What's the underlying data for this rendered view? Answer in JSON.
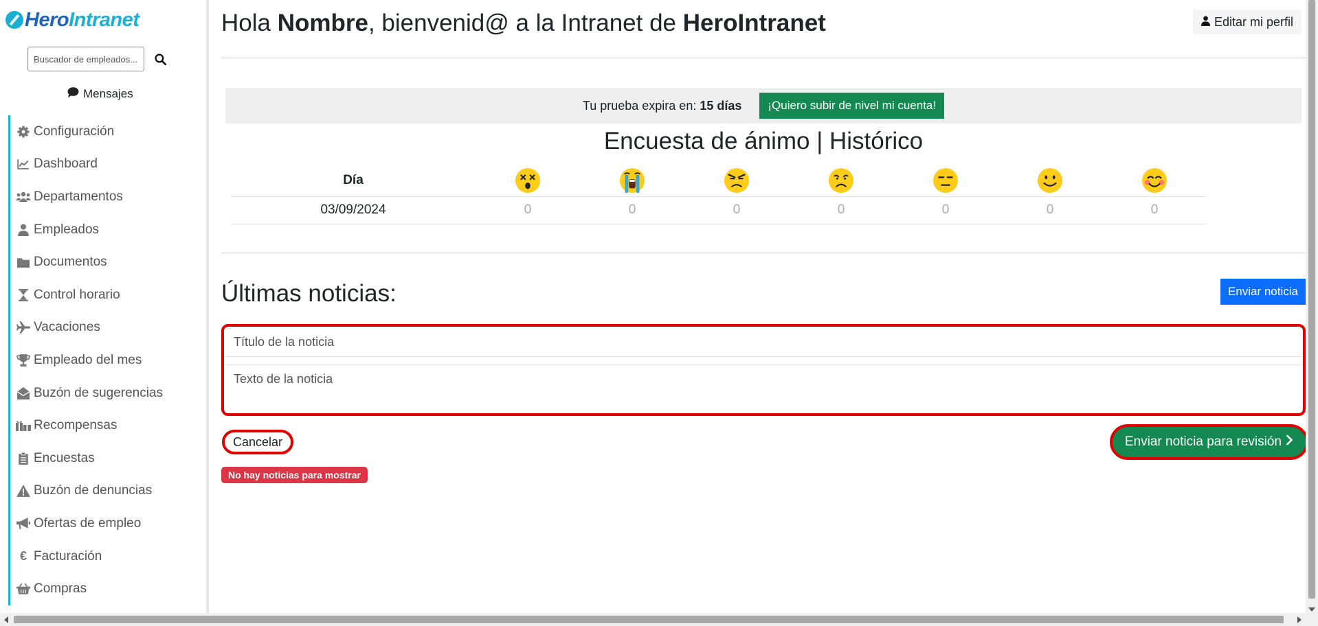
{
  "brand": {
    "name_part1": "Hero",
    "name_part2": "Intranet"
  },
  "search": {
    "placeholder": "Buscador de empleados..."
  },
  "messages": {
    "label": "Mensajes"
  },
  "nav": {
    "items": [
      {
        "label": "Configuración",
        "icon": "gear-icon"
      },
      {
        "label": "Dashboard",
        "icon": "chart-line-icon"
      },
      {
        "label": "Departamentos",
        "icon": "users-icon"
      },
      {
        "label": "Empleados",
        "icon": "user-icon"
      },
      {
        "label": "Documentos",
        "icon": "folder-icon"
      },
      {
        "label": "Control horario",
        "icon": "hourglass-icon"
      },
      {
        "label": "Vacaciones",
        "icon": "plane-icon"
      },
      {
        "label": "Empleado del mes",
        "icon": "trophy-icon"
      },
      {
        "label": "Buzón de sugerencias",
        "icon": "envelope-open-icon"
      },
      {
        "label": "Recompensas",
        "icon": "gifts-icon"
      },
      {
        "label": "Encuestas",
        "icon": "clipboard-icon"
      },
      {
        "label": "Buzón de denuncias",
        "icon": "warning-icon"
      },
      {
        "label": "Ofertas de empleo",
        "icon": "megaphone-icon"
      },
      {
        "label": "Facturación",
        "icon": "euro-icon"
      },
      {
        "label": "Compras",
        "icon": "basket-icon"
      }
    ]
  },
  "header": {
    "greeting_prefix": "Hola ",
    "greeting_name": "Nombre",
    "greeting_middle": ", bienvenid@ a la Intranet de ",
    "greeting_company": "HeroIntranet",
    "edit_profile": "Editar mi perfil"
  },
  "trial": {
    "label": "Tu prueba expira en: ",
    "days": "15 días",
    "upgrade_button": "¡Quiero subir de nivel mi cuenta!"
  },
  "survey": {
    "title": "Encuesta de ánimo | Histórico",
    "day_header": "Día",
    "moods": [
      "dizzy-face-icon",
      "crying-face-icon",
      "angry-face-icon",
      "frowning-face-icon",
      "expressionless-face-icon",
      "slightly-smiling-face-icon",
      "blushing-face-icon"
    ],
    "rows": [
      {
        "day": "03/09/2024",
        "values": [
          "0",
          "0",
          "0",
          "0",
          "0",
          "0",
          "0"
        ]
      }
    ]
  },
  "news": {
    "title": "Últimas noticias:",
    "send_button": "Enviar noticia",
    "title_placeholder": "Título de la noticia",
    "text_placeholder": "Texto de la noticia",
    "cancel_button": "Cancelar",
    "submit_button": "Enviar noticia para revisión",
    "empty_badge": "No hay noticias para mostrar"
  },
  "colors": {
    "brand_dark": "#1e63b8",
    "brand_light": "#1ab0d6",
    "success": "#148a52",
    "primary": "#0d6efd",
    "danger": "#dc3545",
    "highlight": "#e00000"
  }
}
